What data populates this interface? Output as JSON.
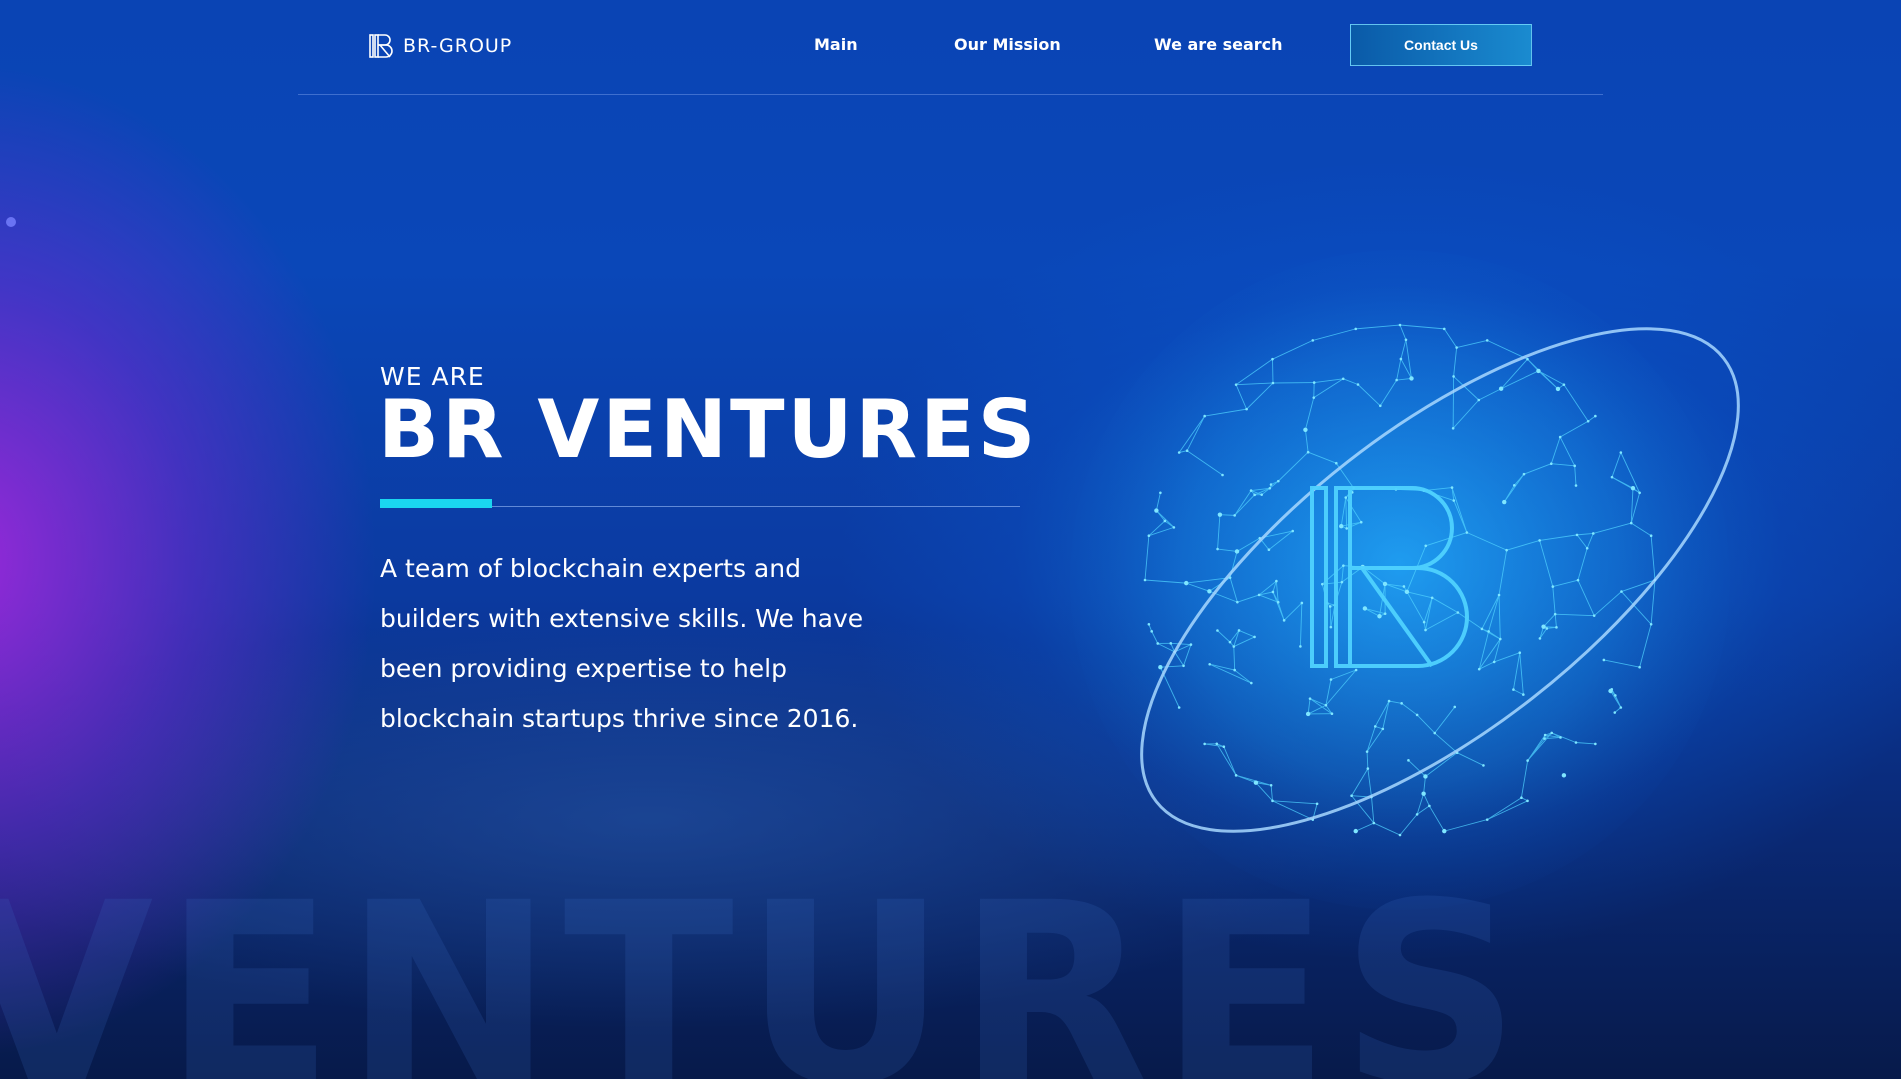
{
  "header": {
    "logo_text": "BR-GROUP",
    "nav": {
      "main": "Main",
      "mission": "Our Mission",
      "search": "We are search"
    },
    "contact_label": "Contact Us"
  },
  "hero": {
    "eyebrow": "WE ARE",
    "title": "BR VENTURES",
    "description": "A team of blockchain experts and builders with extensive skills. We have been providing expertise to help blockchain startups thrive since 2016.",
    "watermark": "VENTURES"
  },
  "colors": {
    "accent": "#1ad6f0",
    "background": "#0a44b4",
    "purple_glow": "#a028dc",
    "globe": "#3cc8ff"
  },
  "icons": {
    "logo": "br-logo-icon",
    "globe": "network-globe-illustration"
  }
}
